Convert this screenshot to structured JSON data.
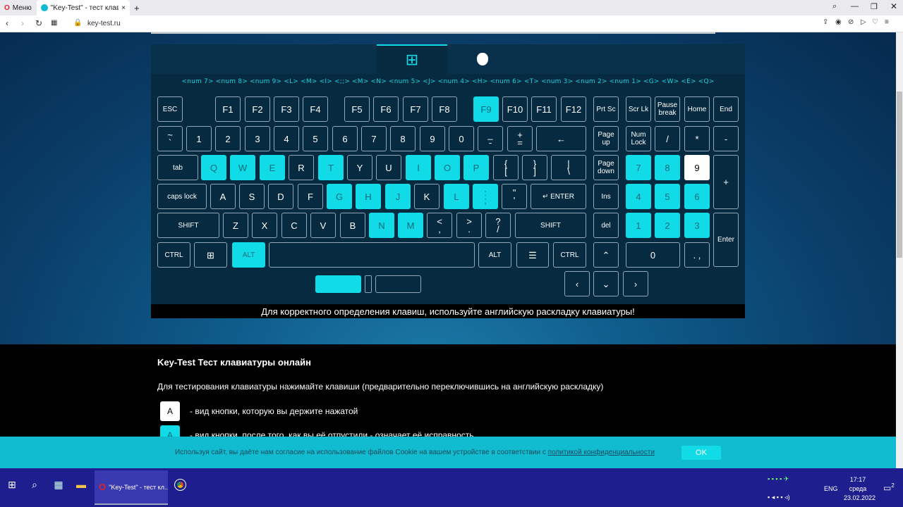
{
  "browser": {
    "tabs": [
      {
        "label": "Меню"
      },
      {
        "label": "\"Key-Test\" - тест клавиату"
      }
    ],
    "new_tab": "+",
    "url": "key-test.ru"
  },
  "keyboard": {
    "os_tabs": {
      "windows": "⊞",
      "mac": ""
    },
    "key_labels_row": "<num 7>  <num 8>  <num 9>  <L>  <M>  <I>  <;;>  <M>  <N>  <num 5>  <J>  <num 4>  <H>  <num 6>  <T>  <num 3>  <num 2>  <num 1>  <G>  <W>  <E>  <Q>",
    "keys": {
      "esc": "ESC",
      "f1": "F1",
      "f2": "F2",
      "f3": "F3",
      "f4": "F4",
      "f5": "F5",
      "f6": "F6",
      "f7": "F7",
      "f8": "F8",
      "f9": "F9",
      "f10": "F10",
      "f11": "F11",
      "f12": "F12",
      "prtsc": "Prt Sc",
      "scrlk": "Scr Lk",
      "pause": "Pause break",
      "home": "Home",
      "end": "End",
      "tilde": "~ `",
      "k1": "1",
      "k2": "2",
      "k3": "3",
      "k4": "4",
      "k5": "5",
      "k6": "6",
      "k7": "7",
      "k8": "8",
      "k9": "9",
      "k0": "0",
      "minus": "_ -",
      "plus": "+ =",
      "backspace": "←",
      "pgup": "Page up",
      "numlock": "Num Lock",
      "nslash": "/",
      "nstar": "*",
      "nminus": "-",
      "tab": "tab",
      "q": "Q",
      "w": "W",
      "e": "E",
      "r": "R",
      "t": "T",
      "y": "Y",
      "u": "U",
      "i": "I",
      "o": "O",
      "p": "P",
      "lbr": "{ [",
      "rbr": "} ]",
      "bslash": "| \\",
      "pgdn": "Page down",
      "n7": "7",
      "n8": "8",
      "n9": "9",
      "nplus": "+",
      "caps": "caps lock",
      "a": "A",
      "s": "S",
      "d": "D",
      "f": "F",
      "g": "G",
      "h": "H",
      "j": "J",
      "k": "K",
      "l": "L",
      "semi": ": ;",
      "quote": "\" '",
      "enter": "↵ ENTER",
      "ins": "Ins",
      "n4": "4",
      "n5": "5",
      "n6": "6",
      "lshift": "SHIFT",
      "z": "Z",
      "x": "X",
      "c": "C",
      "v": "V",
      "b": "B",
      "n": "N",
      "m": "M",
      "comma": "< ,",
      "period": "> .",
      "slash": "? /",
      "rshift": "SHIFT",
      "del": "del",
      "n1": "1",
      "n2": "2",
      "n3": "3",
      "nenter": "Enter",
      "lctrl": "CTRL",
      "win": "⊞",
      "lalt": "ALT",
      "space": "",
      "ralt": "ALT",
      "menu": "☰",
      "rctrl": "CTRL",
      "up": "⌃",
      "n0": "0",
      "ndot": ". ,",
      "left": "‹",
      "down": "⌄",
      "right": "›"
    },
    "message": "Для корректного определения клавиш, используйте английскую раскладку клавиатуры!"
  },
  "info": {
    "title": "Key-Test Тест клавиатуры онлайн",
    "intro": "Для тестирования клавиатуры нажимайте клавиши (предварительно переключившись на английскую раскладку)",
    "legend": [
      {
        "key": "A",
        "text": "- вид кнопки, которую вы держите нажатой"
      },
      {
        "key": "A",
        "text": "- вид кнопки, после того, как вы её отпустили - означает её исправность"
      }
    ]
  },
  "cookie": {
    "text": "Используя сайт, вы даёте нам согласие на использование файлов Cookie на вашем устройстве в соответствии с",
    "link": "политикой конфиденциальности",
    "ok": "OK"
  },
  "taskbar": {
    "app_label": "\"Key-Test\" - тест кл...",
    "lang": "ENG",
    "time": "17:17",
    "day": "среда",
    "date": "23.02.2022",
    "notif": "2"
  },
  "colors": {
    "pressed": "#12dbe8",
    "held": "#ffffff",
    "panel": "#062a3f"
  }
}
